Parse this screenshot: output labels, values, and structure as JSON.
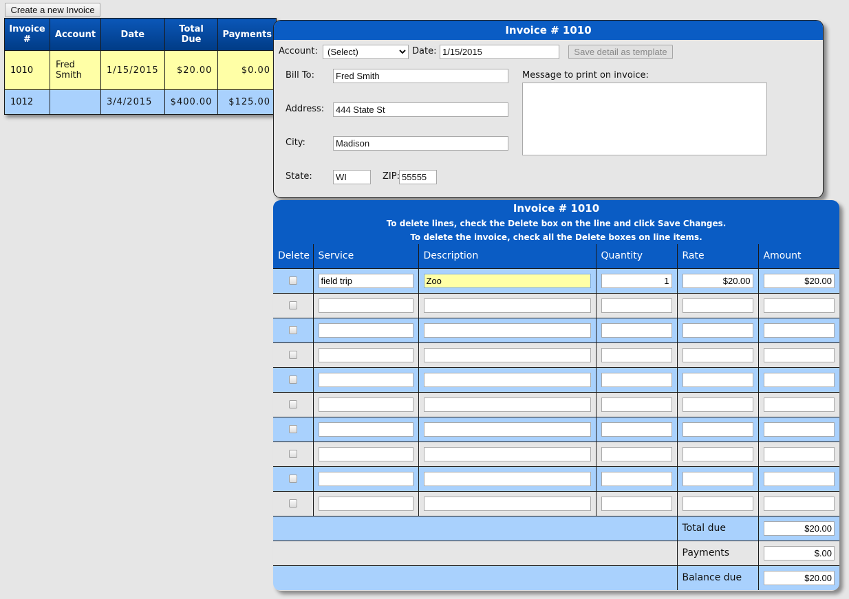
{
  "create_button": "Create a new Invoice",
  "invoice_list": {
    "headers": [
      "Invoice #",
      "Account",
      "Date",
      "Total Due",
      "Payments"
    ],
    "rows": [
      {
        "invoice": "1010",
        "account": "Fred Smith",
        "date": "1/15/2015",
        "total": "$20.00",
        "payments": "$0.00",
        "selected": true
      },
      {
        "invoice": "1012",
        "account": "",
        "date": "3/4/2015",
        "total": "$400.00",
        "payments": "$125.00",
        "selected": false
      }
    ]
  },
  "header": {
    "title": "Invoice # 1010",
    "account_label": "Account:",
    "account_value": "(Select)",
    "date_label": "Date:",
    "date_value": "1/15/2015",
    "template_button": "Save detail as template",
    "bill_to_label": "Bill To:",
    "bill_to_value": "Fred Smith",
    "address_label": "Address:",
    "address_value": "444 State St",
    "city_label": "City:",
    "city_value": "Madison",
    "state_label": "State:",
    "state_value": "WI",
    "zip_label": "ZIP:",
    "zip_value": "55555",
    "message_label": "Message to print on invoice:",
    "message_value": ""
  },
  "detail": {
    "title": "Invoice # 1010",
    "note1": "To delete lines, check the Delete box on the line and click Save Changes.",
    "note2": "To delete the invoice, check all the Delete boxes on line items.",
    "columns": [
      "Delete",
      "Service",
      "Description",
      "Quantity",
      "Rate",
      "Amount"
    ],
    "lines": [
      {
        "service": "field trip",
        "description": "Zoo",
        "quantity": "1",
        "rate": "$20.00",
        "amount": "$20.00"
      },
      {
        "service": "",
        "description": "",
        "quantity": "",
        "rate": "",
        "amount": ""
      },
      {
        "service": "",
        "description": "",
        "quantity": "",
        "rate": "",
        "amount": ""
      },
      {
        "service": "",
        "description": "",
        "quantity": "",
        "rate": "",
        "amount": ""
      },
      {
        "service": "",
        "description": "",
        "quantity": "",
        "rate": "",
        "amount": ""
      },
      {
        "service": "",
        "description": "",
        "quantity": "",
        "rate": "",
        "amount": ""
      },
      {
        "service": "",
        "description": "",
        "quantity": "",
        "rate": "",
        "amount": ""
      },
      {
        "service": "",
        "description": "",
        "quantity": "",
        "rate": "",
        "amount": ""
      },
      {
        "service": "",
        "description": "",
        "quantity": "",
        "rate": "",
        "amount": ""
      },
      {
        "service": "",
        "description": "",
        "quantity": "",
        "rate": "",
        "amount": ""
      }
    ],
    "totals": [
      {
        "label": "Total due",
        "value": "$20.00"
      },
      {
        "label": "Payments",
        "value": "$.00"
      },
      {
        "label": "Balance due",
        "value": "$20.00"
      }
    ]
  },
  "colors": {
    "accent": "#0a5cc4",
    "row_blue": "#a9d1fd",
    "row_selected": "#ffffa6"
  }
}
